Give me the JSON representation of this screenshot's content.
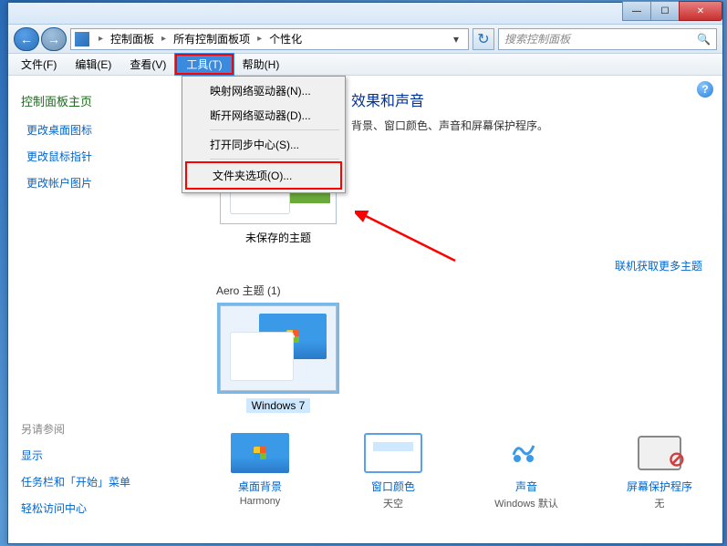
{
  "titlebar": {
    "min": "—",
    "max": "☐",
    "close": "✕"
  },
  "nav": {
    "back": "←",
    "forward": "→",
    "refresh": "↻"
  },
  "breadcrumb": {
    "items": [
      "控制面板",
      "所有控制面板项",
      "个性化"
    ],
    "sep": "▸",
    "drop": "▾"
  },
  "search": {
    "placeholder": "搜索控制面板",
    "icon": "🔍"
  },
  "menubar": {
    "file": "文件(F)",
    "edit": "编辑(E)",
    "view": "查看(V)",
    "tools": "工具(T)",
    "help": "帮助(H)"
  },
  "dropdown": {
    "map_drive": "映射网络驱动器(N)...",
    "disconnect_drive": "断开网络驱动器(D)...",
    "sync_center": "打开同步中心(S)...",
    "folder_options": "文件夹选项(O)..."
  },
  "sidebar": {
    "home": "控制面板主页",
    "links": [
      "更改桌面图标",
      "更改鼠标指针",
      "更改帐户图片"
    ],
    "see_also": "另请参阅",
    "footer_links": [
      "显示",
      "任务栏和「开始」菜单",
      "轻松访问中心"
    ]
  },
  "main": {
    "heading_suffix": "效果和声音",
    "subtitle_suffix": "背景、窗口颜色、声音和屏幕保护程序。",
    "unsaved_theme": "未保存的主题",
    "more_themes": "联机获取更多主题",
    "aero_label": "Aero 主题 (1)",
    "win7_label": "Windows 7",
    "help": "?"
  },
  "bottom": {
    "items": [
      {
        "title": "桌面背景",
        "sub": "Harmony"
      },
      {
        "title": "窗口颜色",
        "sub": "天空"
      },
      {
        "title": "声音",
        "sub": "Windows 默认"
      },
      {
        "title": "屏幕保护程序",
        "sub": "无"
      }
    ]
  }
}
